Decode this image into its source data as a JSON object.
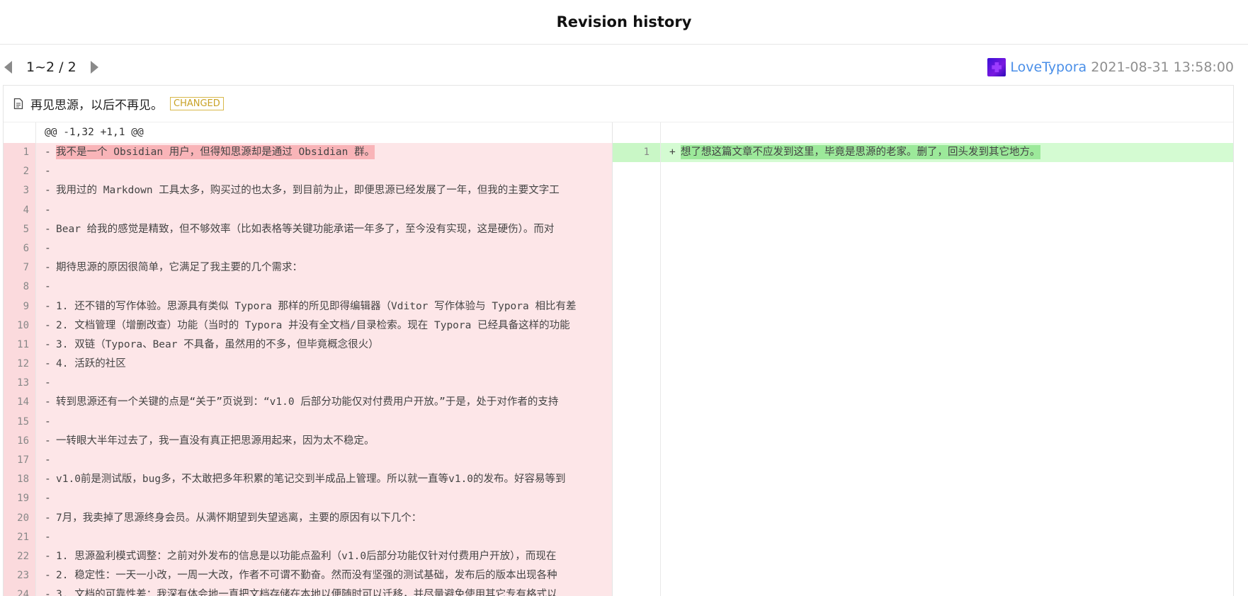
{
  "header": {
    "title": "Revision history"
  },
  "pager": {
    "text": "1~2 / 2"
  },
  "author": {
    "name": "LoveTypora",
    "date": "2021-08-31 13:58:00"
  },
  "file": {
    "name": "再见思源，以后不再见。",
    "status": "CHANGED"
  },
  "diff": {
    "hunk": "@@ -1,32 +1,1 @@",
    "left_lines": [
      {
        "num": "1",
        "sign": "-",
        "text": "我不是一个 Obsidian 用户，但得知思源却是通过 Obsidian 群。",
        "highlight": true
      },
      {
        "num": "2",
        "sign": "-",
        "text": ""
      },
      {
        "num": "3",
        "sign": "-",
        "text": "我用过的 Markdown 工具太多，购买过的也太多，到目前为止，即便思源已经发展了一年，但我的主要文字工"
      },
      {
        "num": "4",
        "sign": "-",
        "text": ""
      },
      {
        "num": "5",
        "sign": "-",
        "text": "Bear 给我的感觉是精致，但不够效率（比如表格等关键功能承诺一年多了，至今没有实现，这是硬伤）。而对"
      },
      {
        "num": "6",
        "sign": "-",
        "text": ""
      },
      {
        "num": "7",
        "sign": "-",
        "text": "期待思源的原因很简单，它满足了我主要的几个需求："
      },
      {
        "num": "8",
        "sign": "-",
        "text": ""
      },
      {
        "num": "9",
        "sign": "-",
        "text": "1. 还不错的写作体验。思源具有类似 Typora 那样的所见即得编辑器（Vditor 写作体验与 Typora 相比有差"
      },
      {
        "num": "10",
        "sign": "-",
        "text": "2. 文档管理（增删改查）功能（当时的 Typora 并没有全文档/目录检索。现在 Typora 已经具备这样的功能"
      },
      {
        "num": "11",
        "sign": "-",
        "text": "3. 双链（Typora、Bear 不具备，虽然用的不多，但毕竟概念很火）"
      },
      {
        "num": "12",
        "sign": "-",
        "text": "4. 活跃的社区"
      },
      {
        "num": "13",
        "sign": "-",
        "text": ""
      },
      {
        "num": "14",
        "sign": "-",
        "text": "转到思源还有一个关键的点是“关于”页说到：“v1.0 后部分功能仅对付费用户开放。”于是，处于对作者的支持"
      },
      {
        "num": "15",
        "sign": "-",
        "text": ""
      },
      {
        "num": "16",
        "sign": "-",
        "text": "一转眼大半年过去了，我一直没有真正把思源用起来，因为太不稳定。"
      },
      {
        "num": "17",
        "sign": "-",
        "text": ""
      },
      {
        "num": "18",
        "sign": "-",
        "text": "v1.0前是测试版，bug多，不太敢把多年积累的笔记交到半成品上管理。所以就一直等v1.0的发布。好容易等到"
      },
      {
        "num": "19",
        "sign": "-",
        "text": ""
      },
      {
        "num": "20",
        "sign": "-",
        "text": "7月，我卖掉了思源终身会员。从满怀期望到失望逃离，主要的原因有以下几个："
      },
      {
        "num": "21",
        "sign": "-",
        "text": ""
      },
      {
        "num": "22",
        "sign": "-",
        "text": "1. 思源盈利模式调整：之前对外发布的信息是以功能点盈利（v1.0后部分功能仅针对付费用户开放），而现在"
      },
      {
        "num": "23",
        "sign": "-",
        "text": "2. 稳定性：一天一小改，一周一大改，作者不可谓不勤奋。然而没有坚强的测试基础，发布后的版本出现各种"
      },
      {
        "num": "24",
        "sign": "-",
        "text": "3. 文档的可靠性差：我深有体会地一直把文档存储在本地以便随时可以迁移，并尽量避免使用其它专有格式以"
      }
    ],
    "right_lines": [
      {
        "num": "1",
        "sign": "+",
        "text": "想了想这篇文章不应发到这里，毕竟是思源的老家。删了，回头发到其它地方。",
        "highlight": true
      }
    ]
  },
  "icons": {
    "prev": "triangle-left-icon",
    "next": "triangle-right-icon",
    "file": "document-icon",
    "decor": "heart-icon"
  },
  "colors": {
    "del_bg": "#fde6e8",
    "add_bg": "#d4fbd2",
    "badge": "#c9a227",
    "author": "#4a8fe8"
  }
}
